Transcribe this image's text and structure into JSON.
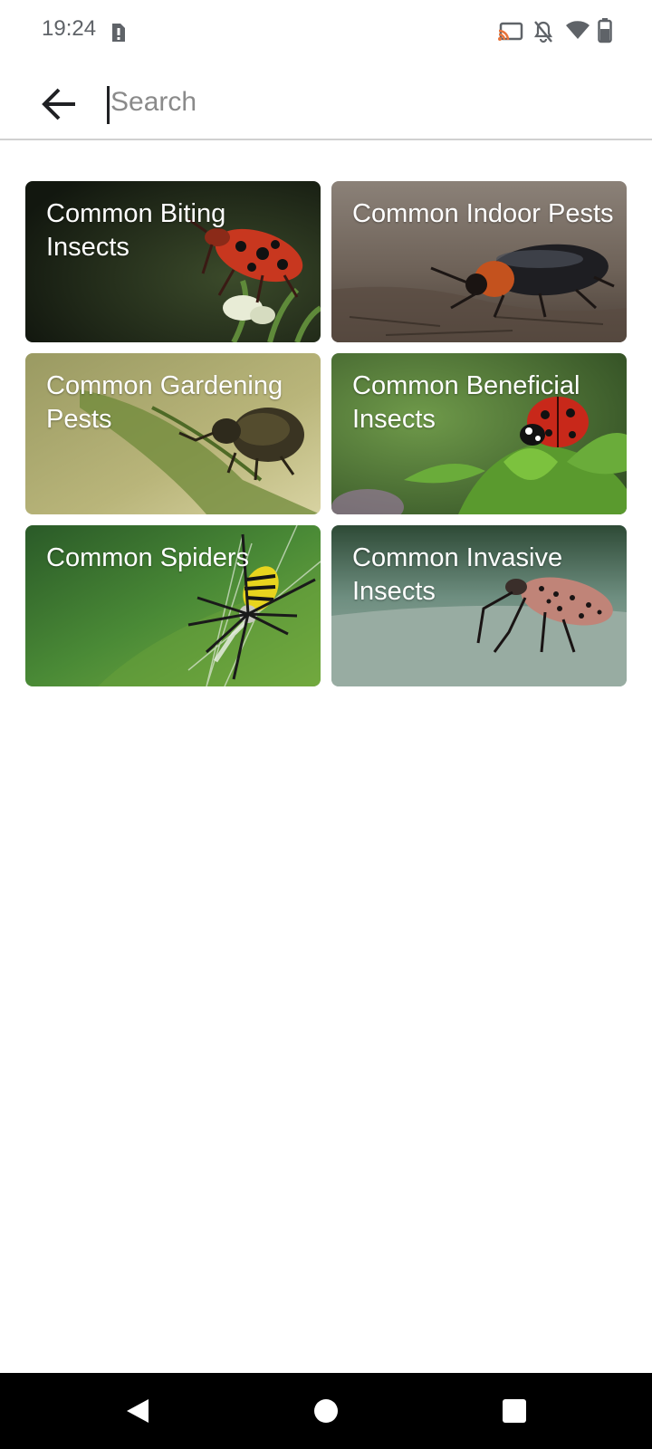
{
  "status_bar": {
    "time": "19:24",
    "icons": [
      "sim-alert-icon",
      "cast-icon",
      "bell-off-icon",
      "wifi-icon",
      "battery-icon"
    ]
  },
  "header": {
    "back_icon": "arrow-left-icon",
    "search": {
      "placeholder": "Search",
      "value": ""
    }
  },
  "categories": [
    {
      "title": "Common Biting Insects",
      "image": "red-black-shield-bug"
    },
    {
      "title": "Common Indoor Pests",
      "image": "black-orange-beetle"
    },
    {
      "title": "Common Gardening Pests",
      "image": "weevil-on-leaf"
    },
    {
      "title": "Common Beneficial Insects",
      "image": "ladybug-on-plant"
    },
    {
      "title": "Common Spiders",
      "image": "wasp-spider-on-web"
    },
    {
      "title": "Common Invasive Insects",
      "image": "spotted-lanternfly"
    }
  ],
  "nav_bar": {
    "buttons": [
      "back-triangle-icon",
      "home-circle-icon",
      "recents-square-icon"
    ]
  }
}
